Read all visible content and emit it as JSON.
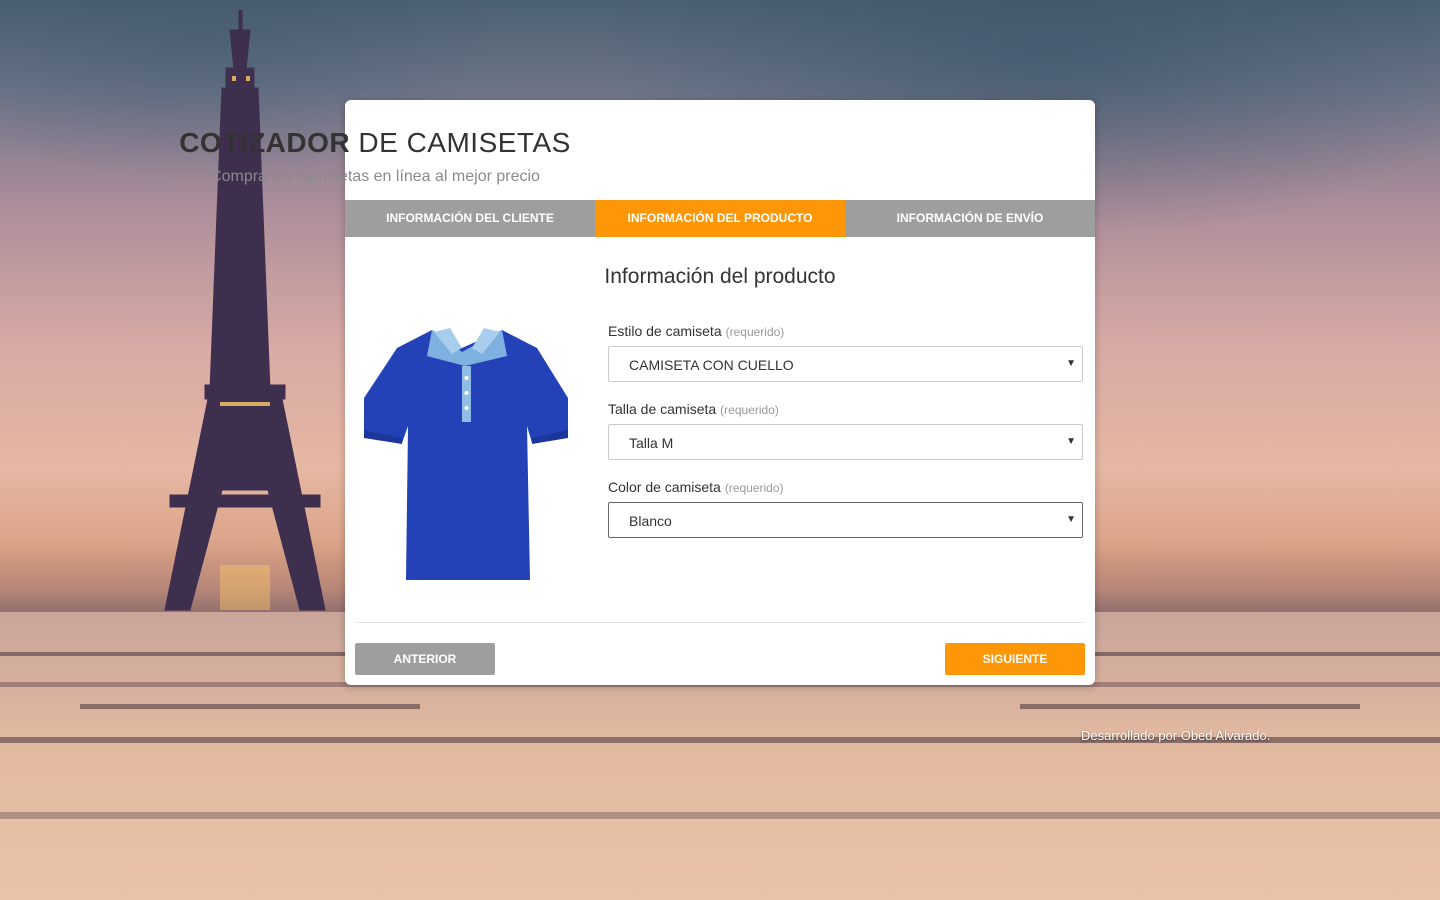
{
  "header": {
    "title_bold": "COTIZADOR",
    "title_rest": " DE CAMISETAS",
    "subtitle": "Compra tus camisetas en línea al mejor precio"
  },
  "tabs": [
    {
      "label": "INFORMACIÓN DEL CLIENTE",
      "active": false
    },
    {
      "label": "INFORMACIÓN DEL PRODUCTO",
      "active": true
    },
    {
      "label": "INFORMACIÓN DE ENVÍO",
      "active": false
    }
  ],
  "section": {
    "title": "Información del producto"
  },
  "product_image": {
    "icon": "polo-shirt-image",
    "color": "#2342b8"
  },
  "form": {
    "required_text": "(requerido)",
    "estilo": {
      "label": "Estilo de camiseta",
      "value": "CAMISETA CON CUELLO"
    },
    "talla": {
      "label": "Talla de camiseta",
      "value": "Talla M"
    },
    "color": {
      "label": "Color de camiseta",
      "value": "Blanco"
    }
  },
  "buttons": {
    "prev_label": "ANTERIOR",
    "next_label": "SIGUIENTE"
  },
  "footer": {
    "credit": "Desarrollado por Obed Alvarado."
  },
  "colors": {
    "accent": "#fe9707",
    "tab_inactive": "#9e9e9e"
  }
}
